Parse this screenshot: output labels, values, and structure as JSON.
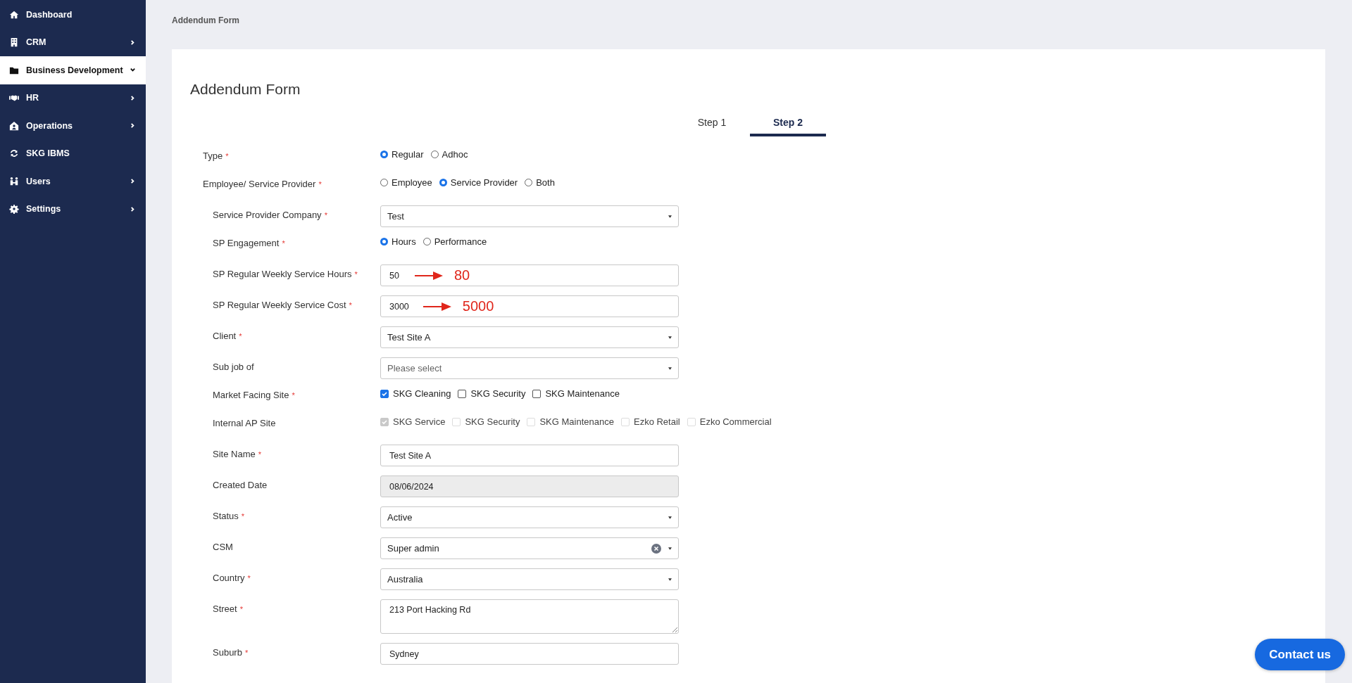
{
  "sidebar": {
    "items": [
      {
        "label": "Dashboard",
        "selected": false
      },
      {
        "label": "CRM",
        "expanded": false,
        "selected": false
      },
      {
        "label": "Business Development",
        "expanded": true,
        "selected": true
      },
      {
        "label": "HR",
        "expanded": false,
        "selected": false
      },
      {
        "label": "Operations",
        "expanded": false,
        "selected": false
      },
      {
        "label": "SKG IBMS",
        "selected": false
      },
      {
        "label": "Users",
        "expanded": false,
        "selected": false
      },
      {
        "label": "Settings",
        "expanded": false,
        "selected": false
      }
    ]
  },
  "breadcrumb": "Addendum Form",
  "form": {
    "title": "Addendum Form",
    "tabs": [
      {
        "label": "Step 1",
        "selected": false
      },
      {
        "label": "Step 2",
        "selected": true
      }
    ],
    "rows": [
      {
        "label": "Type",
        "mark": "*",
        "kind": "radio",
        "options": [
          {
            "label": "Regular",
            "selected": true
          },
          {
            "label": "Adhoc",
            "selected": false
          }
        ]
      },
      {
        "label": "Employee/ Service Provider",
        "mark": "*",
        "kind": "radio",
        "options": [
          {
            "label": "Employee",
            "selected": false
          },
          {
            "label": "Service Provider",
            "selected": true
          },
          {
            "label": "Both",
            "selected": false
          }
        ],
        "children": [
          {
            "label": "Service Provider Company",
            "mark": "*",
            "kind": "select",
            "value": "Test"
          },
          {
            "label": "SP Engagement",
            "mark": "*",
            "kind": "radio",
            "options": [
              {
                "label": "Hours",
                "selected": true
              },
              {
                "label": "Performance",
                "selected": false
              }
            ]
          },
          {
            "label": "SP Regular Weekly Service Hours",
            "mark": "*",
            "kind": "text",
            "value": "50",
            "annotation": "80"
          },
          {
            "label": "SP Regular Weekly Service Cost",
            "mark": "*",
            "kind": "text",
            "value": "3000",
            "annotation": "5000"
          },
          {
            "label": "Client",
            "mark": "*",
            "kind": "select",
            "value": "Test Site A"
          },
          {
            "label": "Sub job of",
            "kind": "select",
            "placeholder": "Please select"
          },
          {
            "label": "Market Facing Site",
            "mark": "*",
            "kind": "checkbox",
            "options": [
              {
                "label": "SKG Cleaning",
                "checked": true,
                "disabled": false
              },
              {
                "label": "SKG Security",
                "checked": false,
                "disabled": false
              },
              {
                "label": "SKG Maintenance",
                "checked": false,
                "disabled": false
              }
            ]
          },
          {
            "label": "Internal AP Site",
            "kind": "checkbox",
            "options": [
              {
                "label": "SKG Service",
                "checked": true,
                "disabled": true
              },
              {
                "label": "SKG Security",
                "checked": false,
                "disabled": true
              },
              {
                "label": "SKG Maintenance",
                "checked": false,
                "disabled": true
              },
              {
                "label": "Ezko Retail",
                "checked": false,
                "disabled": true
              },
              {
                "label": "Ezko Commercial",
                "checked": false,
                "disabled": true
              }
            ]
          },
          {
            "label": "Site Name",
            "mark": "*",
            "kind": "text",
            "value": "Test Site A"
          },
          {
            "label": "Created Date",
            "kind": "text",
            "value": "08/06/2024",
            "disabled": true
          },
          {
            "label": "Status",
            "mark": "*",
            "kind": "select",
            "value": "Active"
          },
          {
            "label": "CSM",
            "kind": "select",
            "value": "Super admin",
            "clearable": true
          },
          {
            "label": "Country",
            "mark": "*",
            "kind": "select",
            "value": "Australia"
          },
          {
            "label": "Street",
            "mark": "*",
            "kind": "textarea",
            "value": "213 Port Hacking Rd"
          },
          {
            "label": "Suburb",
            "mark": "*",
            "kind": "text",
            "value": "Sydney"
          }
        ]
      }
    ]
  },
  "contact_button": "Contact us"
}
